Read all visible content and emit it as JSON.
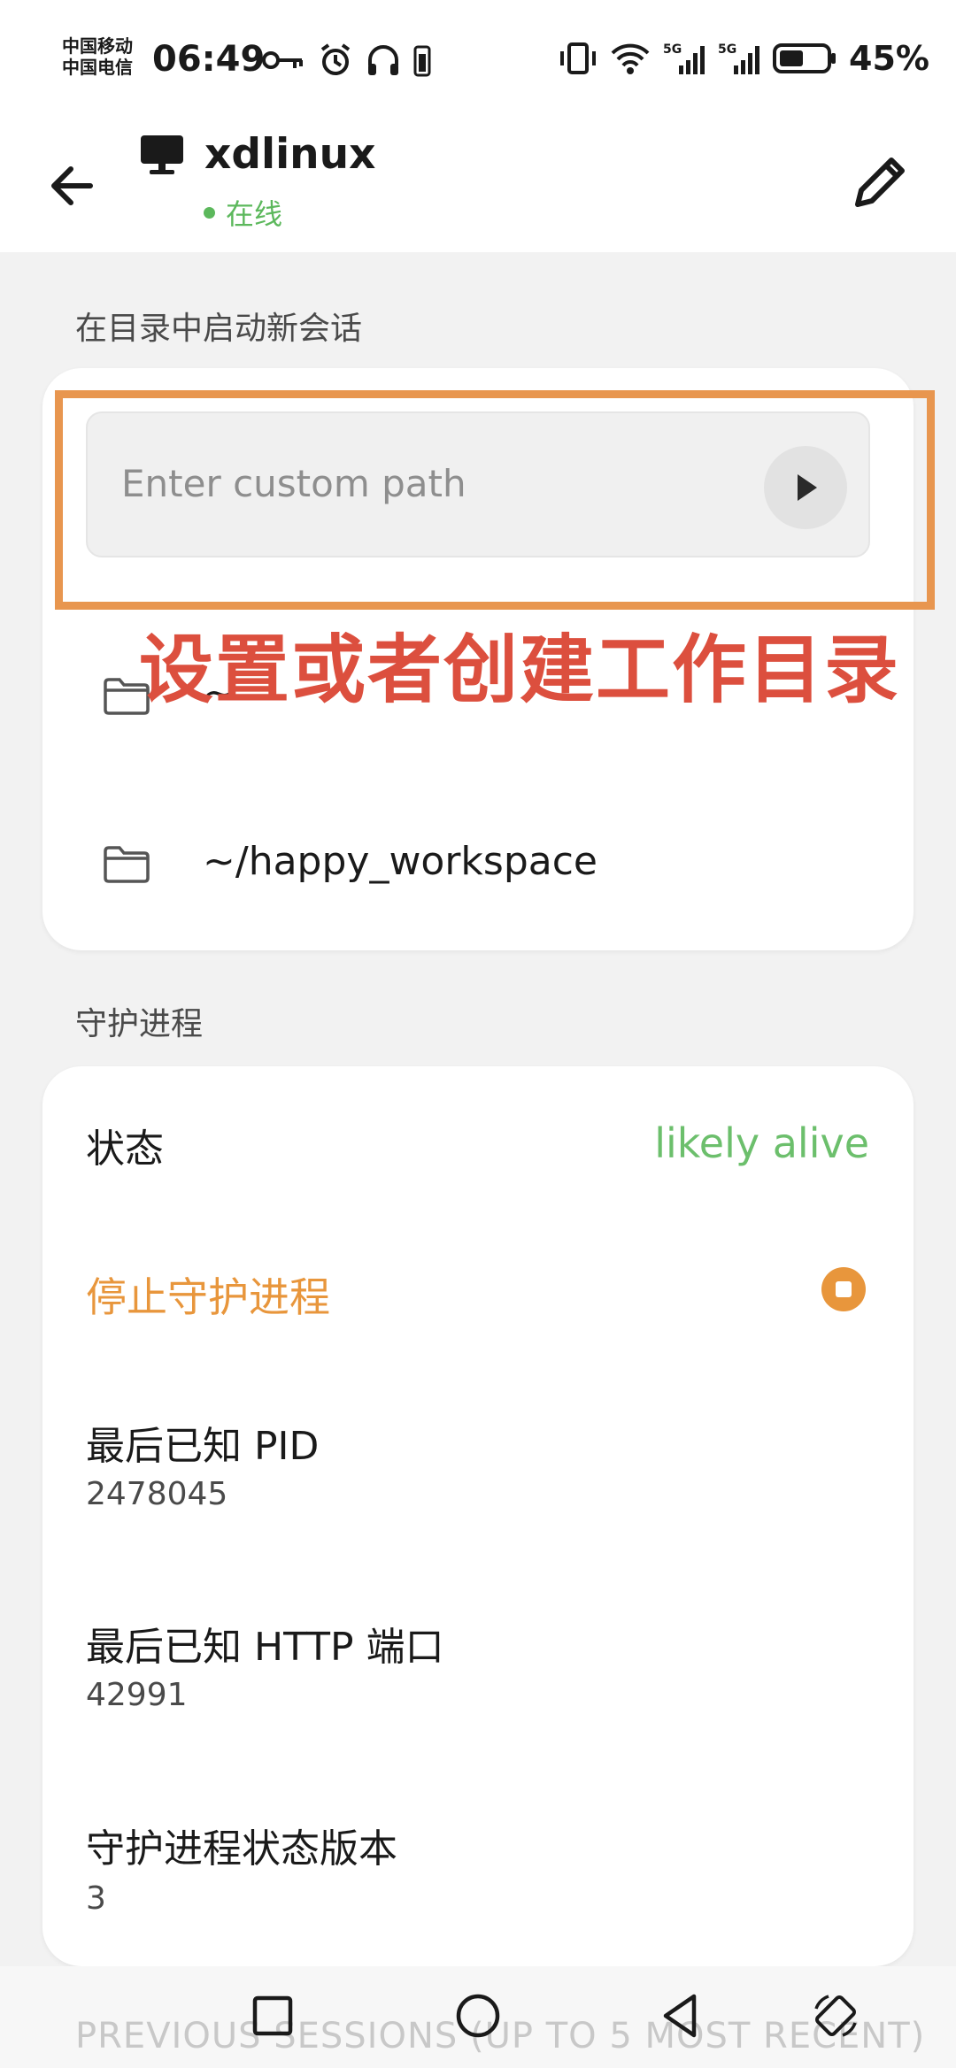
{
  "status_bar": {
    "carrier_1": "中国移动",
    "carrier_2": "中国电信",
    "time": "06:49",
    "battery_percent": "45%",
    "icons": [
      "key-icon",
      "alarm-icon",
      "headphones-icon",
      "vibrate-icon",
      "wifi-icon",
      "signal-5g-icon",
      "signal-5g-icon",
      "battery-icon"
    ]
  },
  "header": {
    "title": "xdlinux",
    "status": "在线",
    "status_color": "#5cb85c"
  },
  "new_session": {
    "section_label": "在目录中启动新会话",
    "path_placeholder": "Enter custom path",
    "folders": [
      "~",
      "~/happy_workspace"
    ]
  },
  "annotation": {
    "text": "设置或者创建工作目录",
    "color": "#dc4f3e",
    "box_color": "#e8964f"
  },
  "daemon": {
    "section_label": "守护进程",
    "status_label": "状态",
    "status_value": "likely alive",
    "stop_label": "停止守护进程",
    "pid_label": "最后已知 PID",
    "pid_value": "2478045",
    "http_port_label": "最后已知 HTTP 端口",
    "http_port_value": "42991",
    "state_version_label": "守护进程状态版本",
    "state_version_value": "3"
  },
  "previous_sessions": {
    "section_label": "PREVIOUS SESSIONS (UP TO 5 MOST RECENT)"
  },
  "nav_bar": {
    "buttons": [
      "recents-button",
      "home-button",
      "back-button",
      "rotate-button"
    ]
  }
}
